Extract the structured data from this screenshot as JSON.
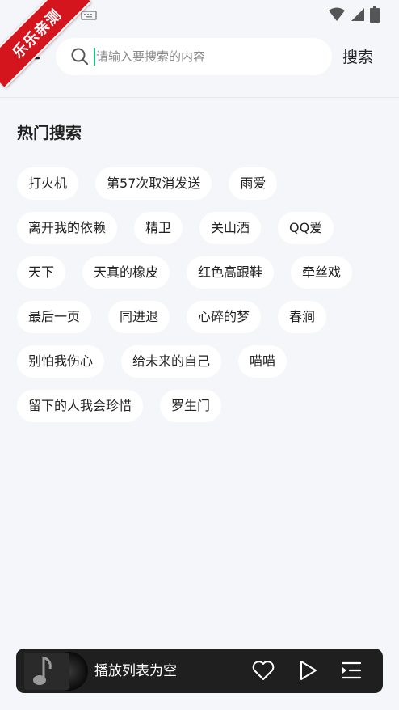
{
  "ribbon": {
    "text": "乐乐亲测"
  },
  "search": {
    "placeholder": "请输入要搜索的内容",
    "value": "",
    "button_label": "搜索"
  },
  "hot": {
    "title": "热门搜索",
    "tags": [
      "打火机",
      "第57次取消发送",
      "雨爱",
      "离开我的依赖",
      "精卫",
      "关山酒",
      "QQ爱",
      "天下",
      "天真的橡皮",
      "红色高跟鞋",
      "牵丝戏",
      "最后一页",
      "同进退",
      "心碎的梦",
      "春涧",
      "别怕我伤心",
      "给未来的自己",
      "喵喵",
      "留下的人我会珍惜",
      "罗生门"
    ]
  },
  "player": {
    "status": "播放列表为空"
  },
  "icons": {
    "back": "arrow-left-icon",
    "search": "search-icon",
    "wifi": "wifi-icon",
    "signal": "signal-icon",
    "keyboard": "keyboard-icon",
    "note": "music-note-icon",
    "like": "heart-icon",
    "play": "play-icon",
    "playlist": "playlist-icon"
  },
  "colors": {
    "accent": "#19c37d",
    "ribbon": "#d4151e",
    "player_bg": "#1f1f1f",
    "page_bg": "#f5f6fa"
  }
}
